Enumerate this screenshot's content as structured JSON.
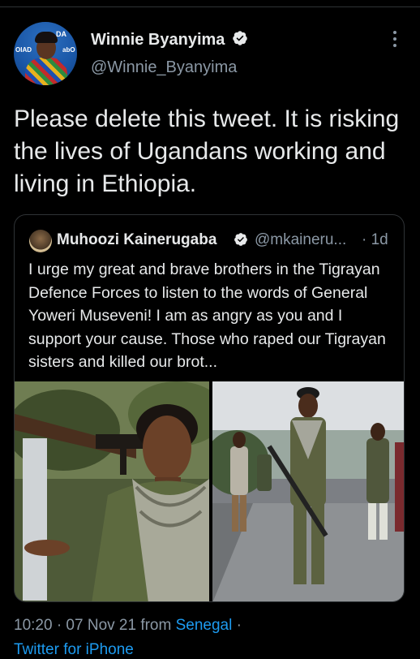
{
  "tweet": {
    "author": {
      "name": "Winnie Byanyima",
      "handle": "@Winnie_Byanyima",
      "avatar_text_1": "DA",
      "avatar_text_2": "OIAD",
      "avatar_text_3": "abO"
    },
    "text": "Please delete this tweet. It is risking the lives of Ugandans working and living in Ethiopia.",
    "time": "10:20 · 07 Nov 21 from ",
    "source_location": "Senegal",
    "separator": " ·",
    "client": "Twitter for iPhone"
  },
  "quoted_tweet": {
    "name": "Muhoozi Kainerugaba",
    "handle": "@mkaineru...",
    "age": "· 1d",
    "text": "I urge my great and brave brothers in the Tigrayan Defence Forces to listen to the words of General Yoweri Museveni! I am as angry as you and I support your cause. Those who raped our Tigrayan sisters and killed our brot..."
  },
  "colors": {
    "background": "#000000",
    "primary_text": "#e7e9ea",
    "secondary_text": "#8b98a5",
    "link": "#1d9bf0",
    "verified_badge": "#e7e9ea",
    "border": "#2f3336"
  },
  "icons": {
    "verified": "verified-badge-icon",
    "more": "more-options-icon"
  }
}
